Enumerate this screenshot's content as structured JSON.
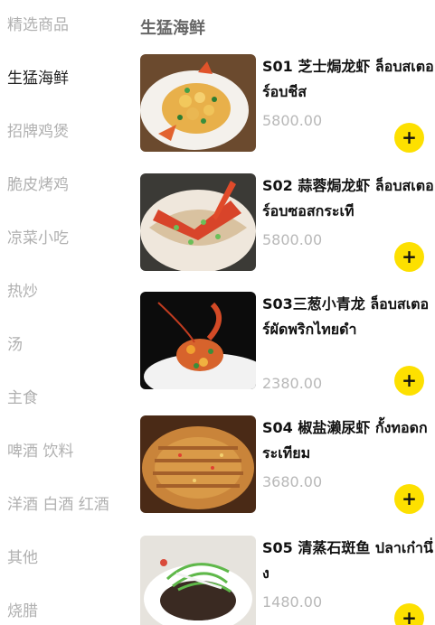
{
  "sidebar": {
    "categories": [
      {
        "label": "精选商品",
        "active": false
      },
      {
        "label": "生猛海鲜",
        "active": true
      },
      {
        "label": "招牌鸡煲",
        "active": false
      },
      {
        "label": "脆皮烤鸡",
        "active": false
      },
      {
        "label": "凉菜小吃",
        "active": false
      },
      {
        "label": "热炒",
        "active": false
      },
      {
        "label": "汤",
        "active": false
      },
      {
        "label": "主食",
        "active": false
      },
      {
        "label": "啤酒 饮料",
        "active": false
      },
      {
        "label": "洋酒 白酒 红酒",
        "active": false
      },
      {
        "label": "其他",
        "active": false
      },
      {
        "label": "烧腊",
        "active": false
      }
    ]
  },
  "main": {
    "section_title": "生猛海鲜",
    "products": [
      {
        "name": "S01 芝士焗龙虾 ล็อบสเตอร์อบชีส",
        "price": "5800.00",
        "add_label": "+",
        "image": "cheese-baked-lobster-photo"
      },
      {
        "name": "S02 蒜蓉焗龙虾 ล็อบสเตอร์อบซอสกระเที",
        "price": "5800.00",
        "add_label": "+",
        "image": "garlic-baked-lobster-photo"
      },
      {
        "name": "S03三葱小青龙 ล็อบสเตอร์ผัดพริกไทยดำ",
        "price": "2380.00",
        "add_label": "+",
        "image": "scallion-lobster-photo"
      },
      {
        "name": "S04 椒盐濑尿虾 กั้งทอดกระเทียม",
        "price": "3680.00",
        "add_label": "+",
        "image": "salt-pepper-mantis-shrimp-photo"
      },
      {
        "name": "S05 清蒸石斑鱼 ปลาเก๋านึ่ง",
        "price": "1480.00",
        "add_label": "+",
        "image": "steamed-grouper-photo"
      }
    ]
  },
  "colors": {
    "accent": "#fde000",
    "sidebar_inactive": "#b0b0b0",
    "sidebar_active": "#222222",
    "price": "#b8b8b8"
  }
}
